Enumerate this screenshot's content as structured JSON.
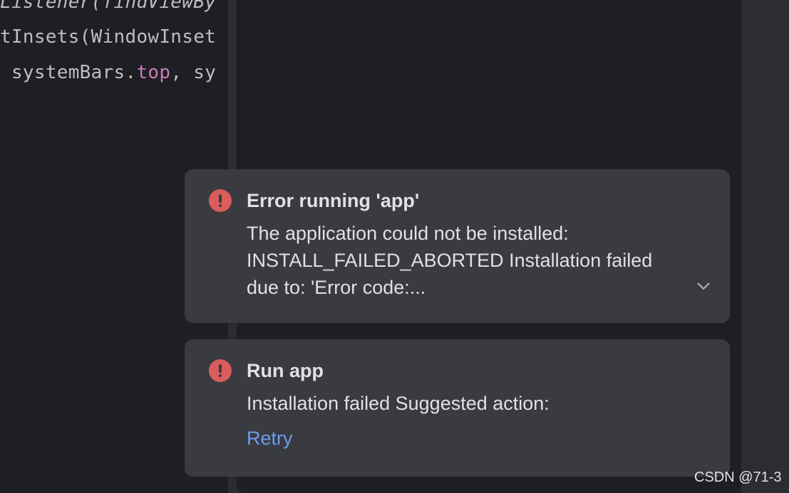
{
  "editor": {
    "line1": "Listener(findViewBy",
    "line2": "tInsets(WindowInset",
    "line3_pre": " systemBars.",
    "line3_field": "top",
    "line3_post": ", sy"
  },
  "notifications": [
    {
      "icon": "error-icon",
      "title": "Error running 'app'",
      "message_lines": [
        "The application could not be installed:",
        "INSTALL_FAILED_ABORTED Installation failed",
        "due to: 'Error code:..."
      ],
      "expand_icon": "chevron-down-icon"
    },
    {
      "icon": "error-icon",
      "title": "Run app",
      "message": "Installation failed Suggested action:",
      "action_label": "Retry"
    }
  ],
  "watermark": "CSDN @71-3",
  "colors": {
    "editor_bg": "#1e1f22",
    "balloon_bg": "#393b40",
    "error_red": "#db5c5c",
    "link_blue": "#6d9bf2",
    "field_purple": "#c77dbb"
  }
}
